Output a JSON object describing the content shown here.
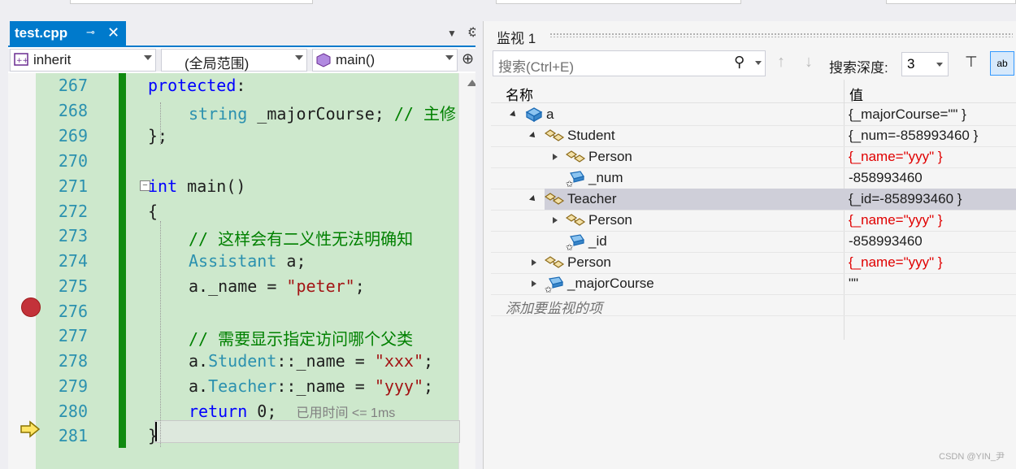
{
  "editor": {
    "tab_title": "test.cpp",
    "tab_pin": "⊸",
    "tab_close": "✕",
    "nav": {
      "project": "inherit",
      "scope": "(全局范围)",
      "function": "main()"
    },
    "lines": [
      {
        "n": "267"
      },
      {
        "n": "268"
      },
      {
        "n": "269"
      },
      {
        "n": "270"
      },
      {
        "n": "271"
      },
      {
        "n": "272"
      },
      {
        "n": "273"
      },
      {
        "n": "274"
      },
      {
        "n": "275"
      },
      {
        "n": "276"
      },
      {
        "n": "277"
      },
      {
        "n": "278"
      },
      {
        "n": "279"
      },
      {
        "n": "280"
      },
      {
        "n": "281"
      }
    ],
    "code": {
      "l267_kw": "protected",
      "l267_rest": ":",
      "l268_ty": "string",
      "l268_rest": " _majorCourse; ",
      "l268_cm": "// 主修",
      "l269": "};",
      "l271_kw": "int",
      "l271_rest": " main()",
      "l272": "{",
      "l273_cm": "// 这样会有二义性无法明确知",
      "l274_ty": "Assistant",
      "l274_rest": " a;",
      "l275_a": "a._name = ",
      "l275_str": "\"peter\"",
      "l275_end": ";",
      "l277_cm": "// 需要显示指定访问哪个父类",
      "l278_a": "a.",
      "l278_ty": "Student",
      "l278_b": "::_name = ",
      "l278_str": "\"xxx\"",
      "l278_end": ";",
      "l279_a": "a.",
      "l279_ty": "Teacher",
      "l279_b": "::_name = ",
      "l279_str": "\"yyy\"",
      "l279_end": ";",
      "l280_kw": "return",
      "l280_rest": " 0;",
      "l280_hint": "已用时间 <= 1ms",
      "l281": "}"
    }
  },
  "watch": {
    "title": "监视 1",
    "search_placeholder": "搜索(Ctrl+E)",
    "depth_label": "搜索深度:",
    "depth_value": "3",
    "col_name": "名称",
    "col_value": "值",
    "rows": [
      {
        "name": "a",
        "value": "{_majorCourse=\"\" }",
        "red": false
      },
      {
        "name": "Student",
        "value": "{_num=-858993460 }",
        "red": false
      },
      {
        "name": "Person",
        "value": "{_name=\"yyy\" }",
        "red": true
      },
      {
        "name": "_num",
        "value": "-858993460",
        "red": false
      },
      {
        "name": "Teacher",
        "value": "{_id=-858993460 }",
        "red": false
      },
      {
        "name": "Person",
        "value": "{_name=\"yyy\" }",
        "red": true
      },
      {
        "name": "_id",
        "value": "-858993460",
        "red": false
      },
      {
        "name": "Person",
        "value": "{_name=\"yyy\" }",
        "red": true
      },
      {
        "name": "_majorCourse",
        "value": "\"\"",
        "red": false
      }
    ],
    "add_item": "添加要监视的项"
  },
  "watermark": "CSDN @YIN_尹",
  "colors": {
    "accent": "#007acc",
    "keyword": "#0000ff",
    "comment": "#008000",
    "string": "#a31515",
    "type": "#2b91af",
    "changed_value": "#e00000"
  }
}
